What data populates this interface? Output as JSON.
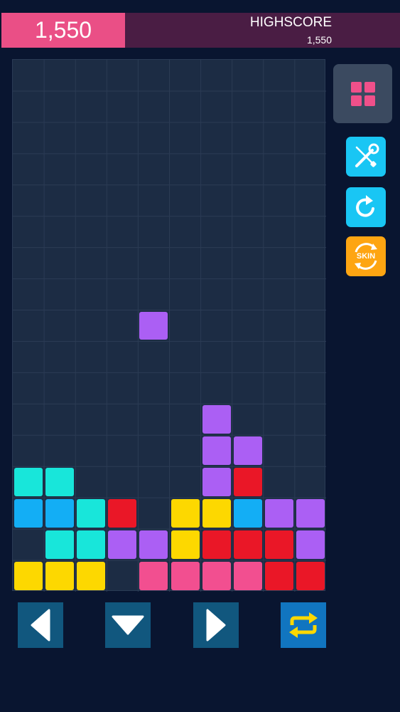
{
  "score": {
    "current": "1,550"
  },
  "highscore": {
    "label": "HIGHSCORE",
    "value": "1,550"
  },
  "board": {
    "columns": 10,
    "rows": 17,
    "colors": {
      "cyan": "#18e6da",
      "blue": "#13aef5",
      "red": "#ea1727",
      "yellow": "#fdd800",
      "purple": "#ab5ff4",
      "pink": "#f24f90"
    },
    "cells": [
      {
        "row": 8,
        "col": 4,
        "color": "purple"
      },
      {
        "row": 11,
        "col": 6,
        "color": "purple"
      },
      {
        "row": 12,
        "col": 6,
        "color": "purple"
      },
      {
        "row": 12,
        "col": 7,
        "color": "purple"
      },
      {
        "row": 13,
        "col": 0,
        "color": "cyan"
      },
      {
        "row": 13,
        "col": 1,
        "color": "cyan"
      },
      {
        "row": 13,
        "col": 6,
        "color": "purple"
      },
      {
        "row": 13,
        "col": 7,
        "color": "red"
      },
      {
        "row": 14,
        "col": 0,
        "color": "blue"
      },
      {
        "row": 14,
        "col": 1,
        "color": "blue"
      },
      {
        "row": 14,
        "col": 2,
        "color": "cyan"
      },
      {
        "row": 14,
        "col": 3,
        "color": "red"
      },
      {
        "row": 14,
        "col": 5,
        "color": "yellow"
      },
      {
        "row": 14,
        "col": 6,
        "color": "yellow"
      },
      {
        "row": 14,
        "col": 7,
        "color": "blue"
      },
      {
        "row": 14,
        "col": 8,
        "color": "purple"
      },
      {
        "row": 14,
        "col": 9,
        "color": "purple"
      },
      {
        "row": 15,
        "col": 1,
        "color": "cyan"
      },
      {
        "row": 15,
        "col": 2,
        "color": "cyan"
      },
      {
        "row": 15,
        "col": 3,
        "color": "purple"
      },
      {
        "row": 15,
        "col": 4,
        "color": "purple"
      },
      {
        "row": 15,
        "col": 5,
        "color": "yellow"
      },
      {
        "row": 15,
        "col": 6,
        "color": "red"
      },
      {
        "row": 15,
        "col": 7,
        "color": "red"
      },
      {
        "row": 15,
        "col": 8,
        "color": "red"
      },
      {
        "row": 15,
        "col": 9,
        "color": "purple"
      },
      {
        "row": 16,
        "col": 0,
        "color": "yellow"
      },
      {
        "row": 16,
        "col": 1,
        "color": "yellow"
      },
      {
        "row": 16,
        "col": 2,
        "color": "yellow"
      },
      {
        "row": 16,
        "col": 4,
        "color": "pink"
      },
      {
        "row": 16,
        "col": 5,
        "color": "pink"
      },
      {
        "row": 16,
        "col": 6,
        "color": "pink"
      },
      {
        "row": 16,
        "col": 7,
        "color": "pink"
      },
      {
        "row": 16,
        "col": 8,
        "color": "red"
      },
      {
        "row": 16,
        "col": 9,
        "color": "red"
      }
    ]
  },
  "side_buttons": {
    "menu": {
      "icon": "grid-icon",
      "color": "#f0508a"
    },
    "tools": {
      "icon": "wrench-screwdriver-icon"
    },
    "restart": {
      "icon": "restart-icon"
    },
    "skin": {
      "icon": "skin-swap-icon",
      "label": "SKIN"
    }
  },
  "controls": {
    "left": {
      "icon": "arrow-left-icon"
    },
    "down": {
      "icon": "arrow-down-icon"
    },
    "right": {
      "icon": "arrow-right-icon"
    },
    "rotate": {
      "icon": "rotate-swap-icon",
      "color": "#fdd800"
    }
  }
}
